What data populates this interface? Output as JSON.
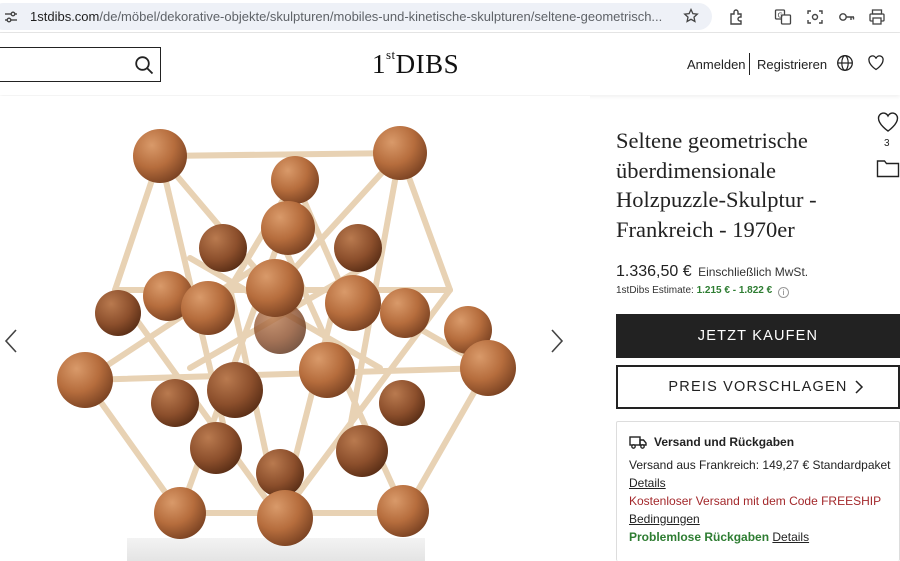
{
  "browser": {
    "url_host": "1stdibs.com",
    "url_path": "/de/möbel/dekorative-objekte/skulpturen/mobiles-und-kinetische-skulpturen/seltene-geometrisch..."
  },
  "header": {
    "search": {
      "value": "",
      "placeholder": ""
    },
    "logo_prefix": "1",
    "logo_sup": "st",
    "logo_main": "DIBS",
    "login": "Anmelden",
    "register": "Registrieren"
  },
  "product": {
    "title": "Seltene geometrische überdimensionale Holzpuzzle-Skulptur - Frankreich - 1970er",
    "favorite_count": "3",
    "price": "1.336,50 €",
    "vat_note": "Einschließlich MwSt.",
    "estimate_label": "1stDibs Estimate:",
    "estimate_range": "1.215 € - 1.822 €",
    "estimate_info": "i",
    "buy_button": "JETZT KAUFEN",
    "offer_button": "PREIS VORSCHLAGEN"
  },
  "shipping": {
    "title": "Versand und Rückgaben",
    "origin_line": "Versand aus Frankreich: 149,27 € Standardpaket",
    "details_link": "Details",
    "promo": "Kostenloser Versand mit dem Code FREESHIP",
    "terms_link": "Bedingungen",
    "returns": "Problemlose Rückgaben",
    "returns_link": "Details"
  },
  "colors": {
    "primary_button": "#222222",
    "estimate_green": "#2e7d32",
    "promo_red": "#a3282b",
    "address_bar": "#eef1f7"
  },
  "icons": [
    "tune-icon",
    "star-icon",
    "extensions-icon",
    "translate-icon",
    "lens-icon",
    "key-icon",
    "print-icon",
    "search-icon",
    "globe-icon",
    "heart-icon",
    "folder-icon",
    "truck-icon",
    "chevron-left-icon",
    "chevron-right-icon"
  ]
}
